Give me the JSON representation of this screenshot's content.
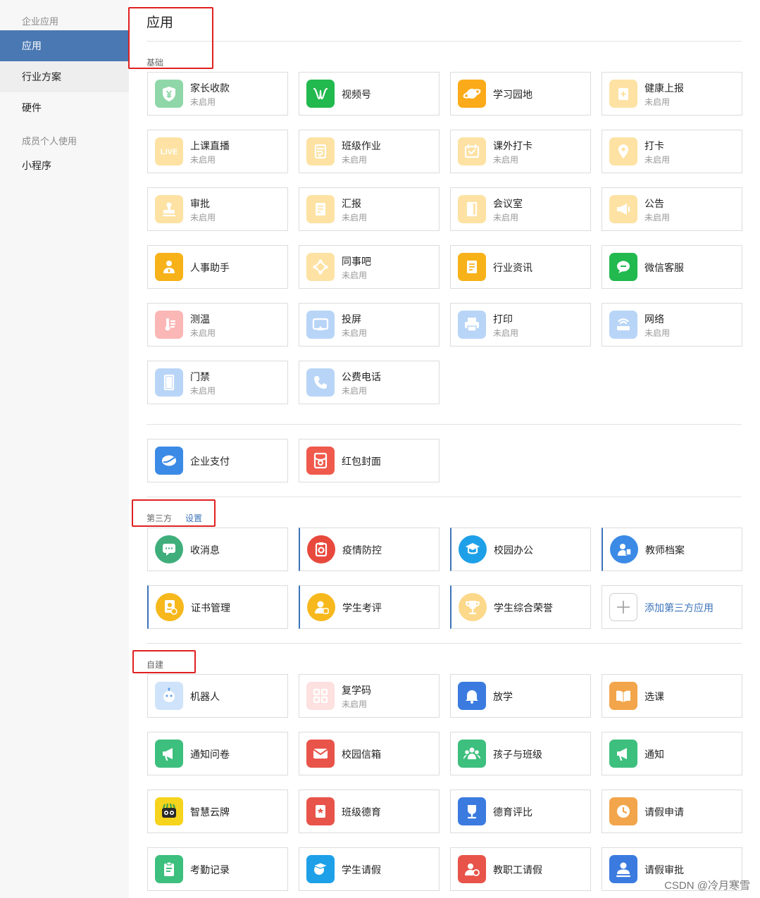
{
  "sidebar": {
    "group1": "企业应用",
    "items1": [
      "应用",
      "行业方案",
      "硬件"
    ],
    "group2": "成员个人使用",
    "items2": [
      "小程序"
    ]
  },
  "page": {
    "title": "应用"
  },
  "sections": {
    "basic": "基础",
    "third": "第三方",
    "third_settings": "设置",
    "custom": "自建"
  },
  "basic_apps": [
    {
      "name": "家长收款",
      "status": "未启用",
      "icon": "yuan-shield-icon",
      "color": "#8fd7a8"
    },
    {
      "name": "视频号",
      "status": "",
      "icon": "video-channel-icon",
      "color": "#22b94f"
    },
    {
      "name": "学习园地",
      "status": "",
      "icon": "planet-icon",
      "color": "#fbaa1a"
    },
    {
      "name": "健康上报",
      "status": "未启用",
      "icon": "health-report-icon",
      "color": "#fde2a3"
    },
    {
      "name": "上课直播",
      "status": "未启用",
      "icon": "live-icon",
      "color": "#fde2a3"
    },
    {
      "name": "班级作业",
      "status": "未启用",
      "icon": "homework-icon",
      "color": "#fde2a3"
    },
    {
      "name": "课外打卡",
      "status": "未启用",
      "icon": "check-calendar-icon",
      "color": "#fde2a3"
    },
    {
      "name": "打卡",
      "status": "未启用",
      "icon": "location-pin-icon",
      "color": "#fde2a3"
    },
    {
      "name": "审批",
      "status": "未启用",
      "icon": "stamp-icon",
      "color": "#fde2a3"
    },
    {
      "name": "汇报",
      "status": "未启用",
      "icon": "report-doc-icon",
      "color": "#fde2a3"
    },
    {
      "name": "会议室",
      "status": "未启用",
      "icon": "door-icon",
      "color": "#fde2a3"
    },
    {
      "name": "公告",
      "status": "未启用",
      "icon": "megaphone-icon",
      "color": "#fde2a3"
    },
    {
      "name": "人事助手",
      "status": "",
      "icon": "person-tie-icon",
      "color": "#f7b21a"
    },
    {
      "name": "同事吧",
      "status": "未启用",
      "icon": "network-nodes-icon",
      "color": "#fde2a3"
    },
    {
      "name": "行业资讯",
      "status": "",
      "icon": "news-doc-icon",
      "color": "#f7b21a"
    },
    {
      "name": "微信客服",
      "status": "",
      "icon": "chat-bubble-icon",
      "color": "#22b94f"
    },
    {
      "name": "测温",
      "status": "未启用",
      "icon": "thermometer-icon",
      "color": "#fbb6b6"
    },
    {
      "name": "投屏",
      "status": "未启用",
      "icon": "cast-screen-icon",
      "color": "#b8d5f7"
    },
    {
      "name": "打印",
      "status": "未启用",
      "icon": "printer-icon",
      "color": "#b8d5f7"
    },
    {
      "name": "网络",
      "status": "未启用",
      "icon": "router-icon",
      "color": "#b8d5f7"
    },
    {
      "name": "门禁",
      "status": "未启用",
      "icon": "access-door-icon",
      "color": "#b8d5f7"
    },
    {
      "name": "公费电话",
      "status": "未启用",
      "icon": "phone-icon",
      "color": "#b8d5f7"
    }
  ],
  "payment_apps": [
    {
      "name": "企业支付",
      "status": "",
      "icon": "pay-swoosh-icon",
      "color": "#3b8ae6"
    },
    {
      "name": "红包封面",
      "status": "",
      "icon": "red-envelope-icon",
      "color": "#ef5a4c"
    }
  ],
  "third_apps": [
    {
      "name": "收消息",
      "status": "",
      "icon": "message-icon",
      "color": "#3fae7b"
    },
    {
      "name": "疫情防控",
      "status": "",
      "icon": "epidemic-icon",
      "color": "#e8493d"
    },
    {
      "name": "校园办公",
      "status": "",
      "icon": "campus-office-icon",
      "color": "#1ea0e8"
    },
    {
      "name": "教师档案",
      "status": "",
      "icon": "teacher-file-icon",
      "color": "#3b8ae6"
    },
    {
      "name": "证书管理",
      "status": "",
      "icon": "certificate-icon",
      "color": "#f6b81c"
    },
    {
      "name": "学生考评",
      "status": "",
      "icon": "student-eval-icon",
      "color": "#f6b81c"
    },
    {
      "name": "学生综合荣誉",
      "status": "",
      "icon": "trophy-icon",
      "color": "#fcd88a"
    },
    {
      "name": "添加第三方应用",
      "status": "",
      "icon": "plus-icon",
      "color": "#ffffff"
    }
  ],
  "custom_apps": [
    {
      "name": "机器人",
      "status": "",
      "icon": "robot-icon",
      "color": "#cfe3fa"
    },
    {
      "name": "复学码",
      "status": "未启用",
      "icon": "qr-grid-icon",
      "color": "#fde0e0"
    },
    {
      "name": "放学",
      "status": "",
      "icon": "bell-icon",
      "color": "#3b7be0"
    },
    {
      "name": "选课",
      "status": "",
      "icon": "book-icon",
      "color": "#f2a54a"
    },
    {
      "name": "通知问卷",
      "status": "",
      "icon": "horn-icon",
      "color": "#3dbf7e"
    },
    {
      "name": "校园信箱",
      "status": "",
      "icon": "mail-icon",
      "color": "#e8544a"
    },
    {
      "name": "孩子与班级",
      "status": "",
      "icon": "group-icon",
      "color": "#3dbf7e"
    },
    {
      "name": "通知",
      "status": "",
      "icon": "notice-horn-icon",
      "color": "#3dbf7e"
    },
    {
      "name": "智慧云牌",
      "status": "",
      "icon": "smart-board-icon",
      "color": "#f6d31c"
    },
    {
      "name": "班级德育",
      "status": "",
      "icon": "moral-badge-icon",
      "color": "#e8544a"
    },
    {
      "name": "德育评比",
      "status": "",
      "icon": "cup-icon",
      "color": "#3b7be0"
    },
    {
      "name": "请假申请",
      "status": "",
      "icon": "clock-icon",
      "color": "#f2a54a"
    },
    {
      "name": "考勤记录",
      "status": "",
      "icon": "clipboard-icon",
      "color": "#3dbf7e"
    },
    {
      "name": "学生请假",
      "status": "",
      "icon": "student-cap-icon",
      "color": "#1ea0e8"
    },
    {
      "name": "教职工请假",
      "status": "",
      "icon": "staff-leave-icon",
      "color": "#e8544a"
    },
    {
      "name": "请假审批",
      "status": "",
      "icon": "approve-person-icon",
      "color": "#3b7be0"
    }
  ],
  "watermark": "CSDN @冷月寒雪"
}
